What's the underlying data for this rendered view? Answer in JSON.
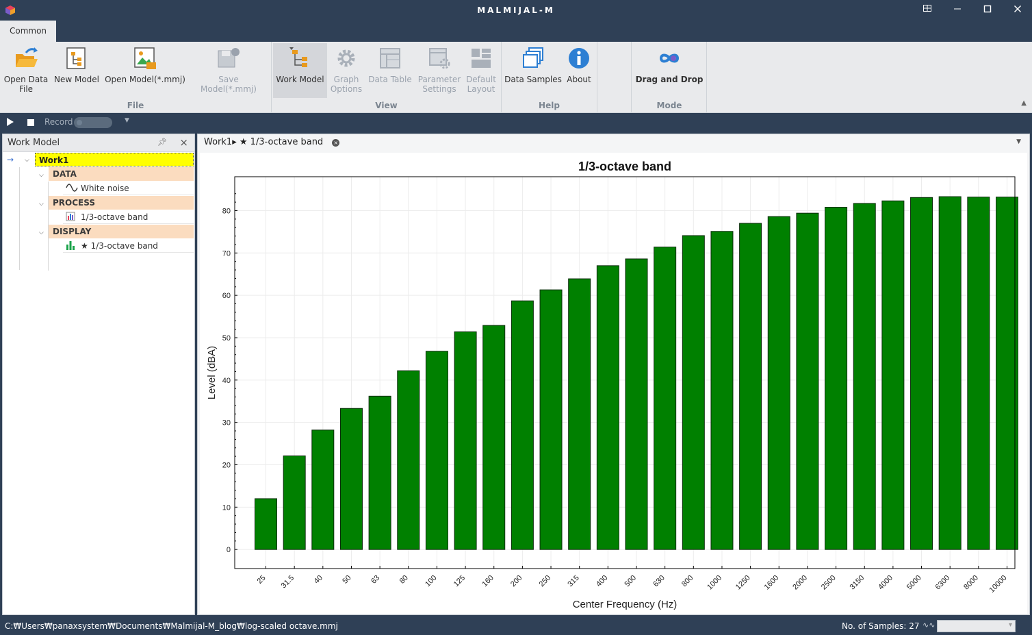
{
  "window": {
    "title": "MALMIJAL-M",
    "icons": [
      "app-cube-icon",
      "restore-icon",
      "minimize-icon",
      "maximize-icon",
      "close-icon"
    ]
  },
  "ribbon": {
    "tab": "Common",
    "buttons": {
      "open_data_file": "Open Data File",
      "new_model": "New Model",
      "open_model": "Open Model(*.mmj)",
      "save_model": "Save Model(*.mmj)",
      "work_model": "Work Model",
      "graph_options": "Graph Options",
      "data_table": "Data Table",
      "parameter_settings": "Parameter Settings",
      "default_layout": "Default Layout",
      "data_samples": "Data Samples",
      "about": "About",
      "drag_and_drop": "Drag and Drop"
    },
    "groups": {
      "file": "File",
      "view": "View",
      "help": "Help",
      "mode": "Mode"
    }
  },
  "recordbar": {
    "record_label": "Record"
  },
  "work_model_panel": {
    "title": "Work Model",
    "root": "Work1",
    "sections": {
      "data": "DATA",
      "process": "PROCESS",
      "display": "DISPLAY"
    },
    "items": {
      "white_noise": "White noise",
      "process_item": "1/3-octave band",
      "display_item": "★ 1/3-octave band"
    }
  },
  "document": {
    "tab_label": "Work1▸ ★ 1/3-octave band"
  },
  "chart_data": {
    "type": "bar",
    "title": "1/3-octave band",
    "xlabel": "Center Frequency (Hz)",
    "ylabel": "Level (dBA)",
    "categories": [
      "25",
      "31.5",
      "40",
      "50",
      "63",
      "80",
      "100",
      "125",
      "160",
      "200",
      "250",
      "315",
      "400",
      "500",
      "630",
      "800",
      "1000",
      "1250",
      "1600",
      "2000",
      "2500",
      "3150",
      "4000",
      "5000",
      "6300",
      "8000",
      "10000"
    ],
    "values": [
      12.0,
      22.1,
      28.2,
      33.3,
      36.2,
      42.2,
      46.8,
      51.4,
      52.9,
      58.7,
      61.3,
      63.9,
      67.0,
      68.6,
      71.4,
      74.1,
      75.1,
      77.0,
      78.6,
      79.4,
      80.8,
      81.7,
      82.3,
      83.1,
      83.3,
      83.2,
      83.2
    ],
    "ylim": [
      -4.5,
      88
    ],
    "yticks": [
      0,
      10,
      20,
      30,
      40,
      50,
      60,
      70,
      80
    ],
    "bar_color": "#008000",
    "grid": true
  },
  "statusbar": {
    "path": "C:₩Users₩panaxsystem₩Documents₩Malmijal-M_blog₩log-scaled octave.mmj",
    "samples": "No. of Samples: 27"
  }
}
